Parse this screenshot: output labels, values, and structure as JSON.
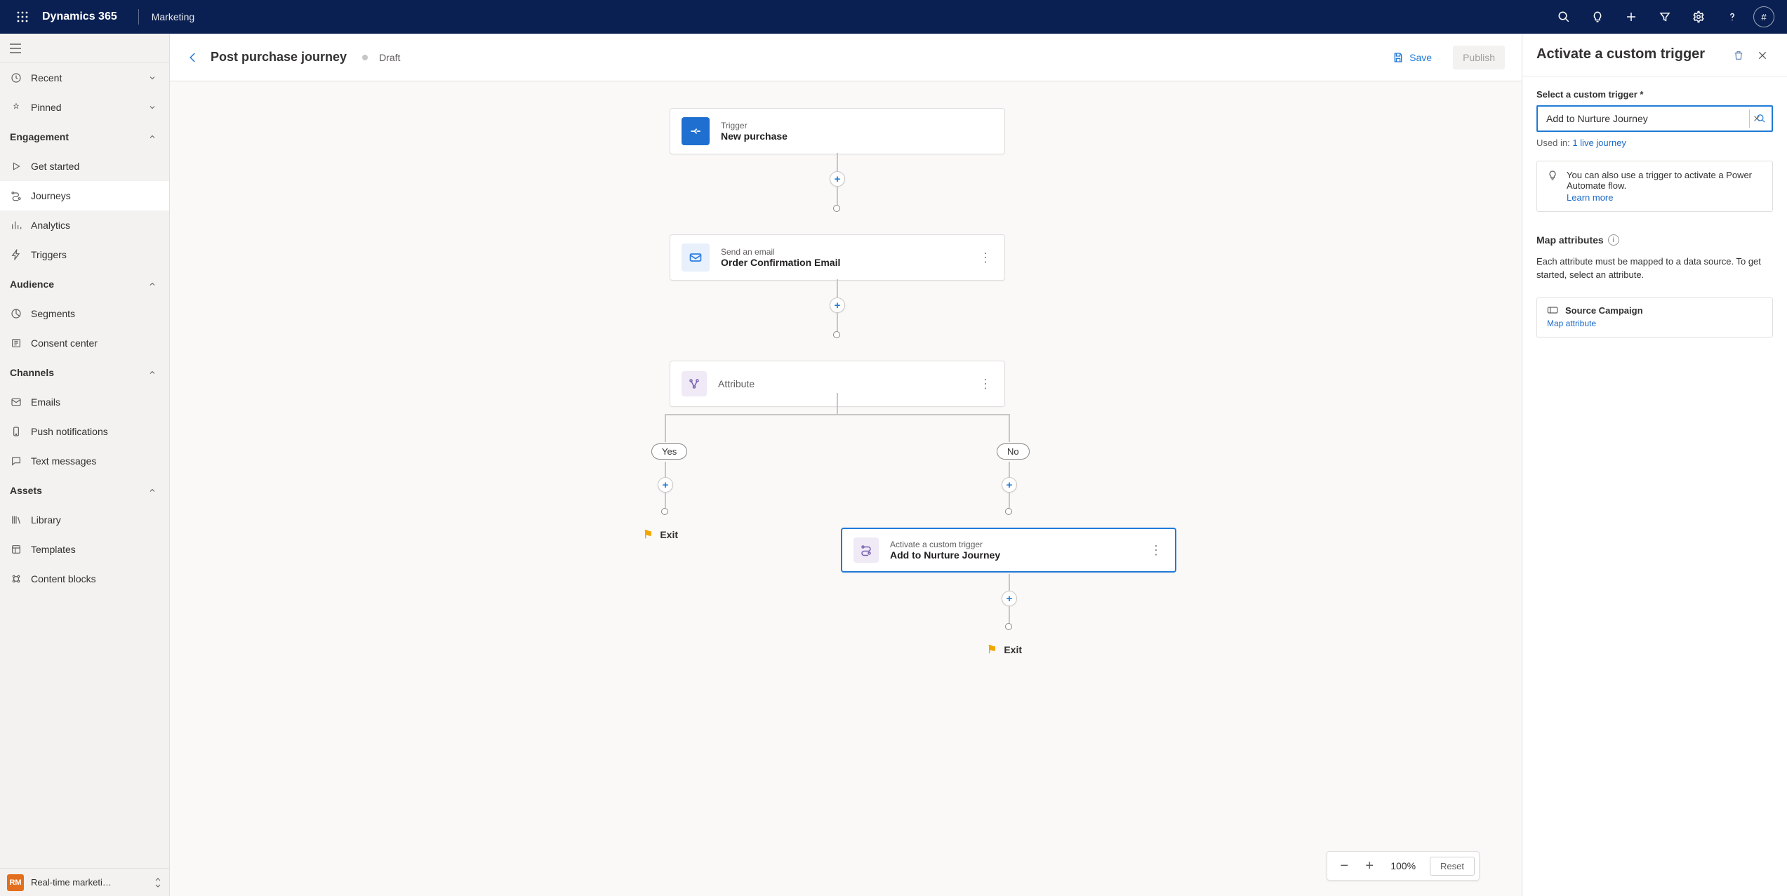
{
  "topbar": {
    "brand": "Dynamics 365",
    "app": "Marketing",
    "avatar": "#"
  },
  "leftnav": {
    "recent": "Recent",
    "pinned": "Pinned",
    "groups": {
      "engagement": {
        "label": "Engagement",
        "items": [
          "Get started",
          "Journeys",
          "Analytics",
          "Triggers"
        ]
      },
      "audience": {
        "label": "Audience",
        "items": [
          "Segments",
          "Consent center"
        ]
      },
      "channels": {
        "label": "Channels",
        "items": [
          "Emails",
          "Push notifications",
          "Text messages"
        ]
      },
      "assets": {
        "label": "Assets",
        "items": [
          "Library",
          "Templates",
          "Content blocks"
        ]
      }
    },
    "footer_badge": "RM",
    "footer_label": "Real-time marketi…"
  },
  "page": {
    "title": "Post purchase journey",
    "status": "Draft",
    "save": "Save",
    "publish": "Publish"
  },
  "nodes": {
    "trigger": {
      "type": "Trigger",
      "title": "New purchase"
    },
    "email": {
      "type": "Send an email",
      "title": "Order Confirmation Email"
    },
    "attr": {
      "title": "Attribute"
    },
    "branch_yes": "Yes",
    "branch_no": "No",
    "activate": {
      "type": "Activate a custom trigger",
      "title": "Add to Nurture Journey"
    },
    "exit": "Exit"
  },
  "zoom": {
    "value": "100%",
    "reset": "Reset"
  },
  "panel": {
    "title": "Activate a custom trigger",
    "select_label": "Select a custom trigger *",
    "select_value": "Add to Nurture Journey",
    "used_in_prefix": "Used in:",
    "used_in_link": "1 live journey",
    "tip": "You can also use a trigger to activate a Power Automate flow.",
    "learn_more": "Learn more",
    "map_title": "Map attributes",
    "map_body": "Each attribute must be mapped to a data source. To get started, select an attribute.",
    "attr_name": "Source Campaign",
    "attr_link": "Map attribute"
  }
}
